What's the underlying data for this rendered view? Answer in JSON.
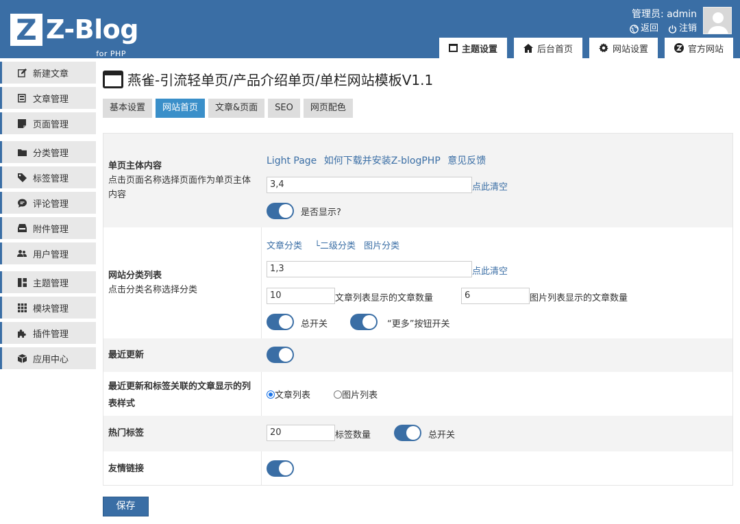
{
  "header": {
    "logo_letter": "Z",
    "logo_text": "Z-Blog",
    "logo_sub": "for PHP",
    "user_line": "管理员: admin",
    "back_label": "返回",
    "logout_label": "注销",
    "tabs": [
      {
        "label": "主题设置",
        "icon": "window-icon"
      },
      {
        "label": "后台首页",
        "icon": "home-icon"
      },
      {
        "label": "网站设置",
        "icon": "gear-icon"
      },
      {
        "label": "官方网站",
        "icon": "zblog-icon"
      }
    ]
  },
  "sidebar": {
    "items": [
      {
        "label": "新建文章",
        "icon": "edit-icon"
      },
      {
        "label": "文章管理",
        "icon": "article-icon"
      },
      {
        "label": "页面管理",
        "icon": "page-icon"
      },
      {
        "label": "分类管理",
        "icon": "folder-icon"
      },
      {
        "label": "标签管理",
        "icon": "tag-icon"
      },
      {
        "label": "评论管理",
        "icon": "comment-icon"
      },
      {
        "label": "附件管理",
        "icon": "attachment-icon"
      },
      {
        "label": "用户管理",
        "icon": "users-icon"
      },
      {
        "label": "主题管理",
        "icon": "theme-icon"
      },
      {
        "label": "模块管理",
        "icon": "module-icon"
      },
      {
        "label": "插件管理",
        "icon": "plugin-icon"
      },
      {
        "label": "应用中心",
        "icon": "app-center-icon"
      }
    ]
  },
  "main": {
    "title": "燕雀-引流轻单页/产品介绍单页/单栏网站模板V1.1",
    "tabs": [
      "基本设置",
      "网站首页",
      "文章&页面",
      "SEO",
      "网页配色"
    ],
    "active_tab": 1,
    "sections": {
      "single_page": {
        "title": "单页主体内容",
        "desc": "点击页面名称选择页面作为单页主体内容",
        "links": [
          "Light Page",
          "如何下载并安装Z-blogPHP",
          "意见反馈"
        ],
        "value": "3,4",
        "clear_label": "点此清空",
        "toggle_label": "是否显示?",
        "show": true
      },
      "categories": {
        "title": "网站分类列表",
        "desc": "点击分类名称选择分类",
        "links": [
          "文章分类",
          "└二级分类",
          "图片分类"
        ],
        "value": "1,3",
        "clear_label": "点此清空",
        "article_count": "10",
        "article_count_label": "文章列表显示的文章数量",
        "image_count": "6",
        "image_count_label": "图片列表显示的文章数量",
        "master_label": "总开关",
        "more_label": "“更多”按钮开关",
        "master_on": true,
        "more_on": true
      },
      "recent": {
        "title": "最近更新",
        "on": true
      },
      "list_style": {
        "title": "最近更新和标签关联的文章显示的列表样式",
        "options": [
          "文章列表",
          "图片列表"
        ],
        "selected": "文章列表"
      },
      "hot_tags": {
        "title": "热门标签",
        "value": "20",
        "count_label": "标签数量",
        "master_label": "总开关",
        "on": true
      },
      "links": {
        "title": "友情链接",
        "on": true
      }
    },
    "save_label": "保存"
  },
  "colors": {
    "header_bg": "#3a6ea5",
    "active_tab": "#3a8fc9",
    "toggle_on": "#3a6ea5"
  }
}
